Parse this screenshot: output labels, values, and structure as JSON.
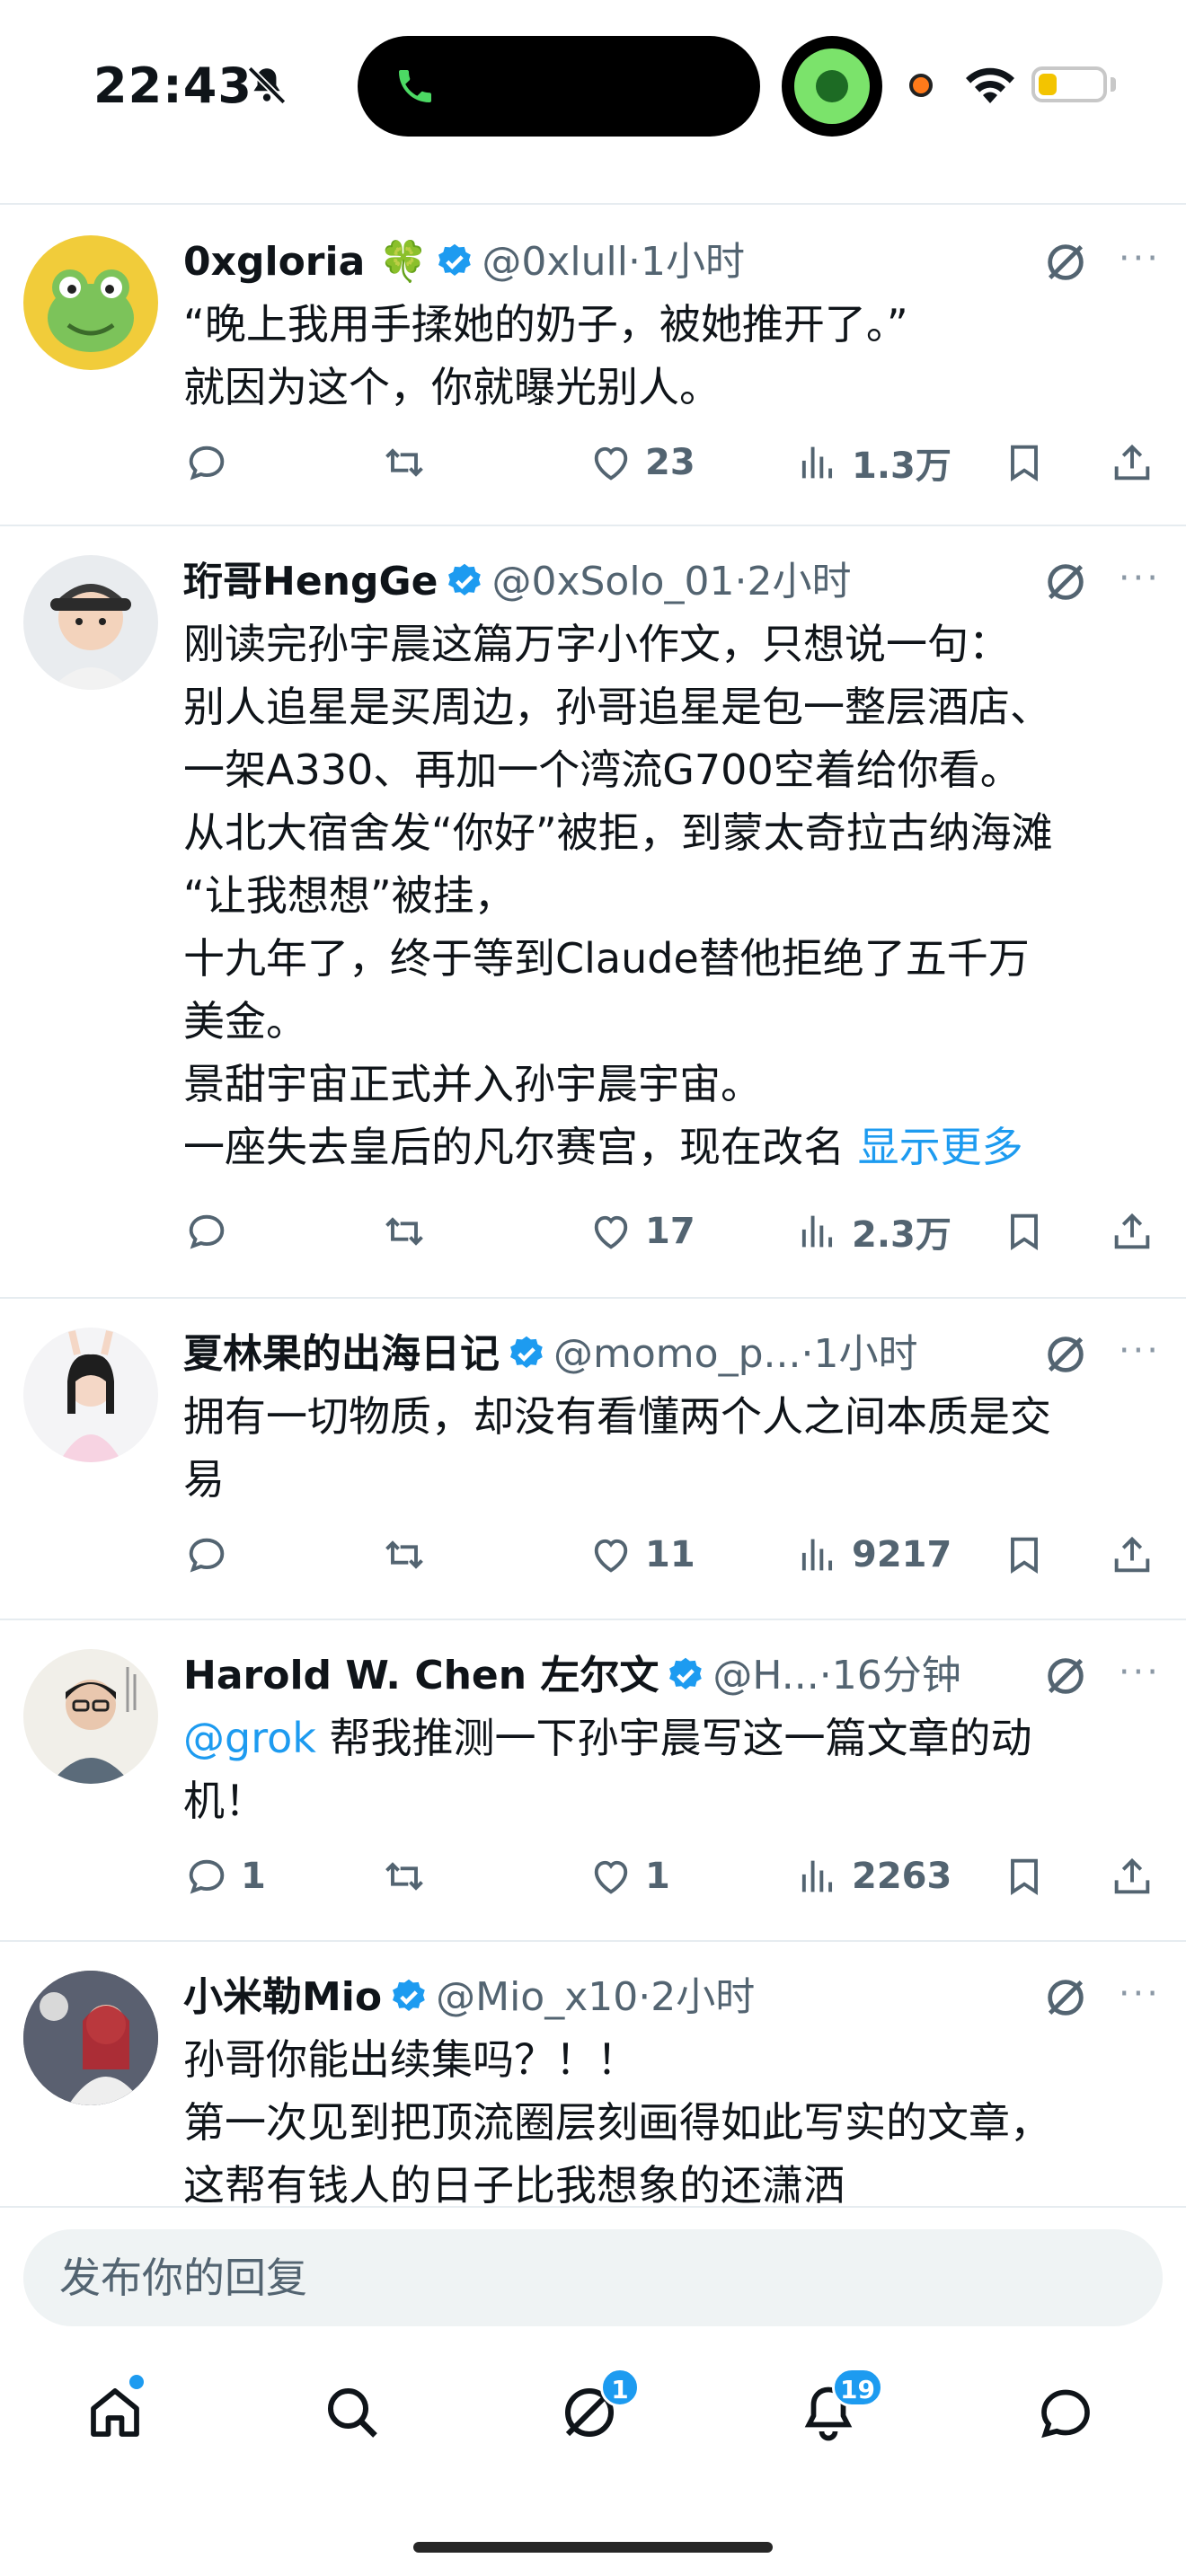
{
  "status_bar": {
    "time": "22:43",
    "battery_level": 0.3
  },
  "colors": {
    "accent": "#1d9bf0",
    "text": "#0f1419",
    "secondary": "#536471"
  },
  "tweets": [
    {
      "name": "0xgloria 🍀",
      "handle": "@0xlull",
      "dot": "·",
      "time": "1小时",
      "lines": [
        "“晚上我用手揉她的奶子，被她推开了。”",
        "就因为这个，你就曝光别人。"
      ],
      "reply_count": "",
      "like_count": "23",
      "view_count": "1.3万"
    },
    {
      "name": "珩哥HengGe",
      "handle": "@0xSolo_01",
      "dot": "·",
      "time": "2小时",
      "lines": [
        "刚读完孙宇晨这篇万字小作文，只想说一句：",
        "别人追星是买周边，孙哥追星是包一整层酒店、",
        "一架A330、再加一个湾流G700空着给你看。",
        "从北大宿舍发“你好”被拒，到蒙太奇拉古纳海滩",
        "“让我想想”被挂，",
        "十九年了，终于等到Claude替他拒绝了五千万",
        "美金。",
        "景甜宇宙正式并入孙宇晨宇宙。",
        "一座失去皇后的凡尔赛宫，现在改名"
      ],
      "show_more": "显示更多",
      "reply_count": "",
      "like_count": "17",
      "view_count": "2.3万"
    },
    {
      "name": "夏林果的出海日记",
      "handle": "@momo_p...",
      "dot": "·",
      "time": "1小时",
      "lines": [
        "拥有一切物质，却没有看懂两个人之间本质是交",
        "易"
      ],
      "reply_count": "",
      "like_count": "11",
      "view_count": "9217"
    },
    {
      "name": "Harold W. Chen 左尔文",
      "handle": "@H...",
      "dot": "·",
      "time": "16分钟",
      "mention": "@grok",
      "lines": [
        " 帮我推测一下孙宇晨写这一篇文章的动",
        "机！"
      ],
      "reply_count": "1",
      "like_count": "1",
      "view_count": "2263"
    },
    {
      "name": "小米勒Mio",
      "handle": "@Mio_x10",
      "dot": "·",
      "time": "2小时",
      "lines": [
        "孙哥你能出续集吗？！！",
        "第一次见到把顶流圈层刻画得如此写实的文章，",
        "这帮有钱人的日子比我想象的还潇洒"
      ]
    }
  ],
  "reply_box": {
    "placeholder": "发布你的回复"
  },
  "tab_bar": {
    "grok_badge": "1",
    "notifications_badge": "19"
  },
  "more_glyph": "···"
}
